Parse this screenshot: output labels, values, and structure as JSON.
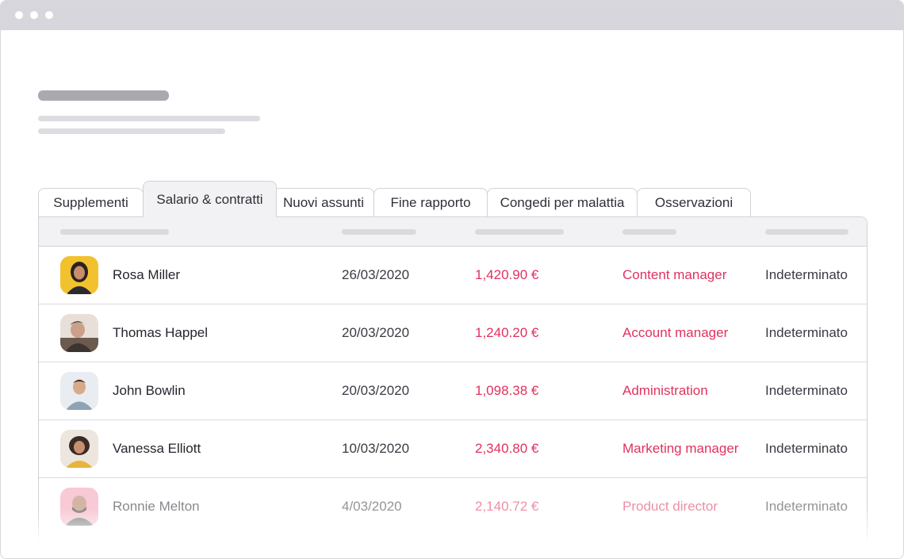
{
  "tabs": [
    {
      "label": "Supplementi"
    },
    {
      "label": "Salario & contratti"
    },
    {
      "label": "Nuovi assunti"
    },
    {
      "label": "Fine rapporto"
    },
    {
      "label": "Congedi per malattia"
    },
    {
      "label": "Osservazioni"
    }
  ],
  "active_tab": "Salario & contratti",
  "rows": [
    {
      "name": "Rosa Miller",
      "date": "26/03/2020",
      "amount": "1,420.90 €",
      "role": "Content manager",
      "contract": "Indeterminato"
    },
    {
      "name": "Thomas Happel",
      "date": "20/03/2020",
      "amount": "1,240.20 €",
      "role": "Account manager",
      "contract": "Indeterminato"
    },
    {
      "name": "John Bowlin",
      "date": "20/03/2020",
      "amount": "1,098.38 €",
      "role": "Administration",
      "contract": "Indeterminato"
    },
    {
      "name": "Vanessa Elliott",
      "date": "10/03/2020",
      "amount": "2,340.80 €",
      "role": "Marketing manager",
      "contract": "Indeterminato"
    },
    {
      "name": "Ronnie Melton",
      "date": "4/03/2020",
      "amount": "2,140.72 €",
      "role": "Product director",
      "contract": "Indeterminato"
    }
  ],
  "colors": {
    "accent": "#e0325e",
    "titlebar": "#d6d6dc",
    "header_bg": "#f2f2f4",
    "skeleton_dark": "#a9a9b0",
    "skeleton_light": "#dcdce1"
  }
}
